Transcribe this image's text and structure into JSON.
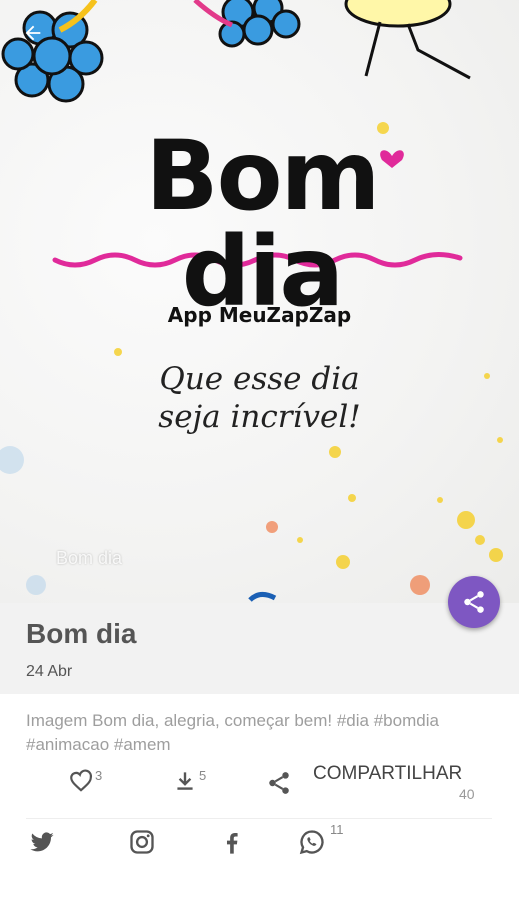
{
  "hero": {
    "title": "Bom dia",
    "app_name": "App MeuZapZap",
    "quote_line1": "Que esse dia",
    "quote_line2": "seja incrível!",
    "watermark": "Bom dia"
  },
  "post": {
    "title": "Bom dia",
    "date": "24 Abr",
    "description": "Imagem Bom dia, alegria, começar bem! #dia #bomdia #animacao #amem"
  },
  "actions": {
    "likes": "3",
    "downloads": "5",
    "share_label": "COMPARTILHAR",
    "share_count": "40",
    "whatsapp_count": "11"
  },
  "colors": {
    "accent": "#7e57c2",
    "wave": "#e02a9a",
    "flower": "#3a9be0"
  },
  "icons": [
    "back-arrow-icon",
    "share-icon",
    "heart-icon",
    "download-icon",
    "twitter-icon",
    "instagram-icon",
    "facebook-icon",
    "whatsapp-icon"
  ]
}
